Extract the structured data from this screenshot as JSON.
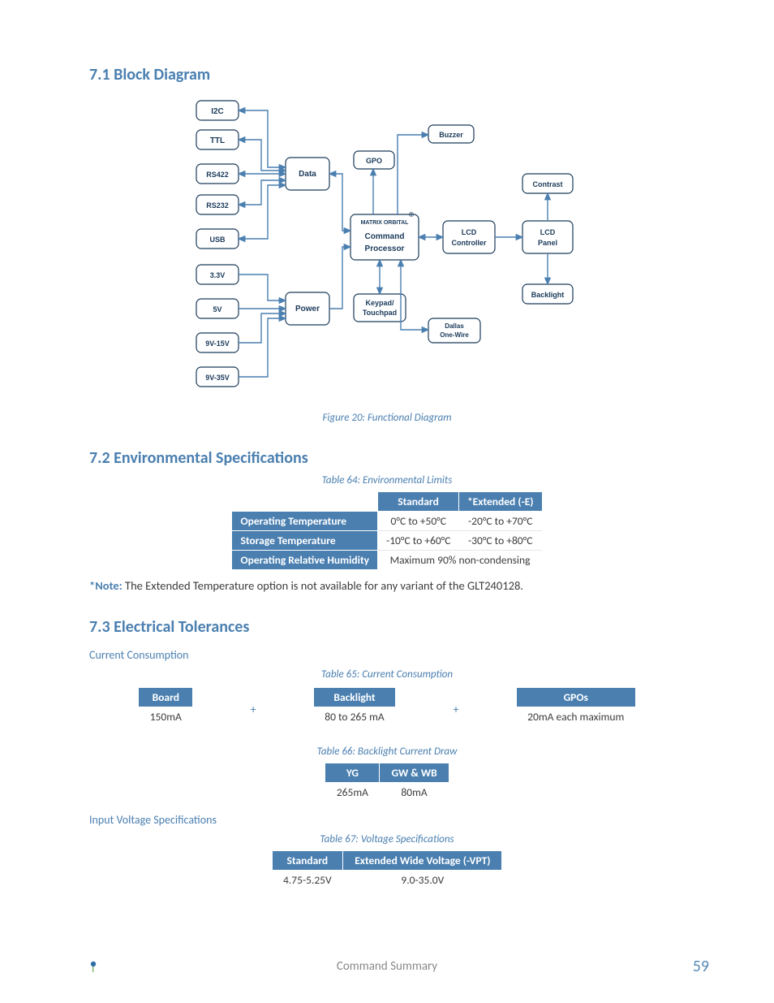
{
  "sections": {
    "s71": "7.1 Block Diagram",
    "s72": "7.2 Environmental Specifications",
    "s73": "7.3 Electrical Tolerances"
  },
  "captions": {
    "fig20": "Figure 20: Functional Diagram",
    "t64": "Table 64: Environmental Limits",
    "t65": "Table 65: Current Consumption",
    "t66": "Table 66: Backlight Current Draw",
    "t67": "Table 67: Voltage Specifications"
  },
  "subheads": {
    "current_consumption": "Current Consumption",
    "input_voltage": "Input Voltage Specifications"
  },
  "note": {
    "prefix": "*Note:",
    "text": " The Extended Temperature option is not available for any variant of the GLT240128."
  },
  "diagram": {
    "i2c": "I2C",
    "ttl": "TTL",
    "rs422": "RS422",
    "rs232": "RS232",
    "usb": "USB",
    "v33": "3.3V",
    "v5": "5V",
    "v9_15": "9V-15V",
    "v9_35": "9V-35V",
    "data": "Data",
    "power": "Power",
    "gpo": "GPO",
    "buzzer": "Buzzer",
    "brand": "MATRIX ORBITAL",
    "cmdproc_l1": "Command",
    "cmdproc_l2": "Processor",
    "keypad_l1": "Keypad/",
    "keypad_l2": "Touchpad",
    "dallas_l1": "Dallas",
    "dallas_l2": "One-Wire",
    "lcdctrl_l1": "LCD",
    "lcdctrl_l2": "Controller",
    "lcdpanel_l1": "LCD",
    "lcdpanel_l2": "Panel",
    "contrast": "Contrast",
    "backlight": "Backlight"
  },
  "env_table": {
    "h_standard": "Standard",
    "h_extended": "*Extended (-E)",
    "r1_label": "Operating Temperature",
    "r1_std": "0°C to +50°C",
    "r1_ext": "-20°C to +70°C",
    "r2_label": "Storage Temperature",
    "r2_std": "-10°C to +60°C",
    "r2_ext": "-30°C to +80°C",
    "r3_label": "Operating Relative Humidity",
    "r3_val": "Maximum 90% non-condensing"
  },
  "consumption_table": {
    "h_board": "Board",
    "h_backlight": "Backlight",
    "h_gpos": "GPOs",
    "v_board": "150mA",
    "v_backlight": "80 to 265 mA",
    "v_gpos": "20mA each maximum",
    "plus": "+"
  },
  "backlight_draw_table": {
    "h_yg": "YG",
    "h_gwwb": "GW & WB",
    "v_yg": "265mA",
    "v_gwwb": "80mA"
  },
  "voltage_table": {
    "h_std": "Standard",
    "h_ext": "Extended Wide Voltage (-VPT)",
    "v_std": "4.75-5.25V",
    "v_ext": "9.0-35.0V"
  },
  "footer": {
    "center": "Command Summary",
    "page": "59"
  }
}
